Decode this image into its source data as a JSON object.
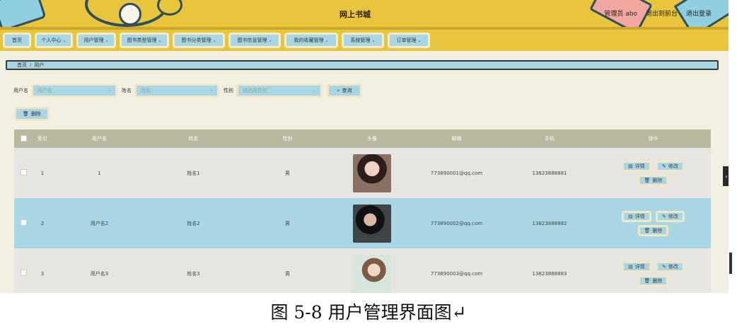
{
  "header": {
    "title": "网上书城",
    "user_label": "管理员 abo",
    "front_link": "退出到前台",
    "logout_link": "退出登录"
  },
  "nav": {
    "items": [
      {
        "label": "首页",
        "chev": ""
      },
      {
        "label": "个人中心",
        "chev": "⌄"
      },
      {
        "label": "用户管理",
        "chev": "⌄"
      },
      {
        "label": "图书类型管理",
        "chev": "⌄"
      },
      {
        "label": "图书分类管理",
        "chev": "⌄"
      },
      {
        "label": "图书信息管理",
        "chev": "⌄"
      },
      {
        "label": "我的收藏管理",
        "chev": "⌄"
      },
      {
        "label": "系统管理",
        "chev": "⌄"
      },
      {
        "label": "订单管理",
        "chev": "⌄"
      }
    ]
  },
  "breadcrumb": {
    "home": "首页",
    "sep": "/",
    "current": "用户"
  },
  "search": {
    "username_label": "用户名",
    "username_placeholder": "用户名",
    "name_label": "姓名",
    "name_placeholder": "姓名",
    "gender_label": "性别",
    "gender_placeholder": "请选择性别",
    "query_label": "查询"
  },
  "actions": {
    "delete_label": "删除"
  },
  "table": {
    "headers": [
      "索引",
      "用户名",
      "姓名",
      "性别",
      "头像",
      "邮箱",
      "手机",
      "操作"
    ],
    "rows": [
      {
        "index": "1",
        "username": "1",
        "name": "姓名1",
        "gender": "男",
        "email": "773890001@qq.com",
        "phone": "13823888881"
      },
      {
        "index": "2",
        "username": "用户名2",
        "name": "姓名2",
        "gender": "男",
        "email": "773890002@qq.com",
        "phone": "13823888882"
      },
      {
        "index": "3",
        "username": "用户名3",
        "name": "姓名3",
        "gender": "男",
        "email": "773890003@qq.com",
        "phone": "13823888883"
      }
    ],
    "op_detail": "详情",
    "op_edit": "修改",
    "op_delete": "删除"
  },
  "caption": "图 5-8 用户管理界面图↵",
  "colors": {
    "header": "#e8c53a",
    "accent": "#a9d6e5",
    "table_head": "#b8b7a0"
  }
}
